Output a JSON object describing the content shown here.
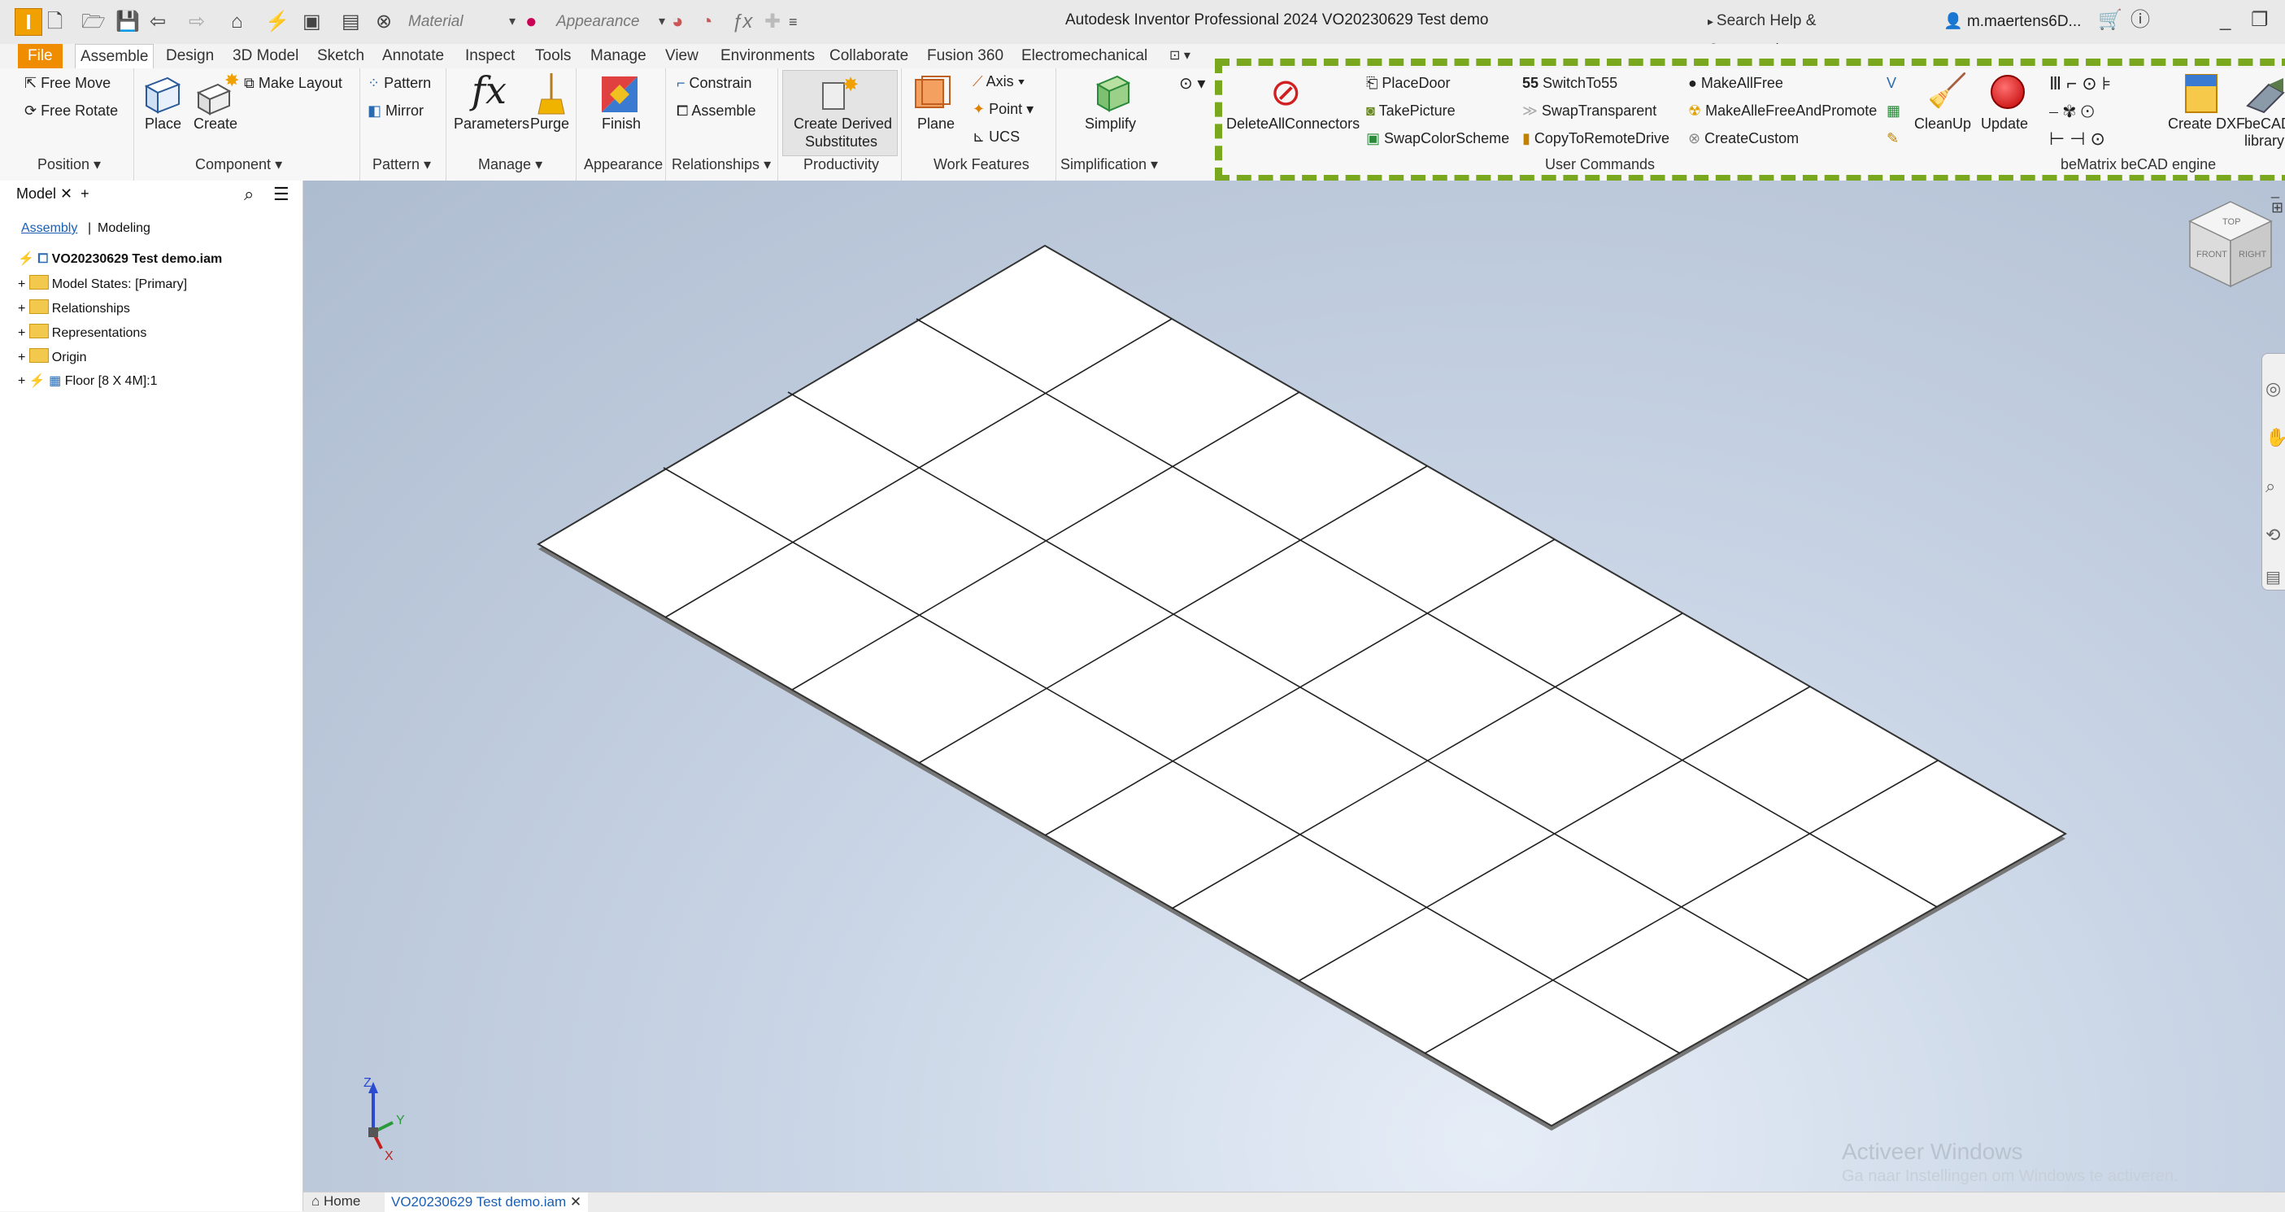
{
  "app": {
    "logo_letter": "I",
    "window_title": "Autodesk Inventor Professional 2024   VO20230629 Test demo",
    "material_placeholder": "Material",
    "appearance_placeholder": "Appearance",
    "search_label": "Search Help & Commands...",
    "user_name": "m.maertens6D...",
    "accent_color": "#f08c00",
    "frame_color": "#79a81e"
  },
  "tabs": [
    "File",
    "Assemble",
    "Design",
    "3D Model",
    "Sketch",
    "Annotate",
    "Inspect",
    "Tools",
    "Manage",
    "View",
    "Environments",
    "Collaborate",
    "Fusion 360",
    "Electromechanical"
  ],
  "ribbon": {
    "free_move": "Free Move",
    "free_rotate": "Free Rotate",
    "place": "Place",
    "create": "Create",
    "make_layout": "Make Layout",
    "pattern": "Pattern",
    "mirror": "Mirror",
    "parameters": "Parameters",
    "purge": "Purge",
    "finish": "Finish",
    "constrain": "Constrain",
    "assemble": "Assemble",
    "create_derived_1": "Create Derived",
    "create_derived_2": "Substitutes",
    "plane": "Plane",
    "axis": "Axis",
    "point": "Point",
    "ucs": "UCS",
    "simplify": "Simplify",
    "delete_all_connectors": "DeleteAllConnectors",
    "place_door": "PlaceDoor",
    "take_picture": "TakePicture",
    "swap_color_scheme": "SwapColorScheme",
    "switch_to_55": "SwitchTo55",
    "switch_num": "55",
    "swap_transparent": "SwapTransparent",
    "copy_to_remote_drive": "CopyToRemoteDrive",
    "make_all_free": "MakeAllFree",
    "make_all_free_promote": "MakeAlleFreeAndPromote",
    "create_custom": "CreateCustom",
    "cleanup": "CleanUp",
    "update": "Update",
    "create_dxf": "Create DXF",
    "becad_1": "beCAD",
    "becad_2": "library"
  },
  "panels": {
    "position": "Position",
    "component": "Component",
    "pattern": "Pattern",
    "manage": "Manage",
    "appearance": "Appearance",
    "relationships": "Relationships",
    "productivity": "Productivity",
    "work_features": "Work Features",
    "simplification": "Simplification",
    "user_commands": "User Commands",
    "bematrix": "beMatrix beCAD engine"
  },
  "browser": {
    "tab_label": "Model",
    "assembly": "Assembly",
    "modeling": "Modeling",
    "root": "VO20230629 Test demo.iam",
    "items": [
      "Model States: [Primary]",
      "Relationships",
      "Representations",
      "Origin",
      "Floor [8 X 4M]:1"
    ]
  },
  "viewcube": {
    "top": "TOP",
    "front": "FRONT",
    "right": "RIGHT"
  },
  "triad": {
    "z": "Z",
    "y": "Y",
    "x": "X"
  },
  "doc_tabs": {
    "home": "Home",
    "active": "VO20230629 Test demo.iam"
  },
  "watermark": {
    "line1": "Activeer Windows",
    "line2": "Ga naar Instellingen om Windows te activeren."
  }
}
